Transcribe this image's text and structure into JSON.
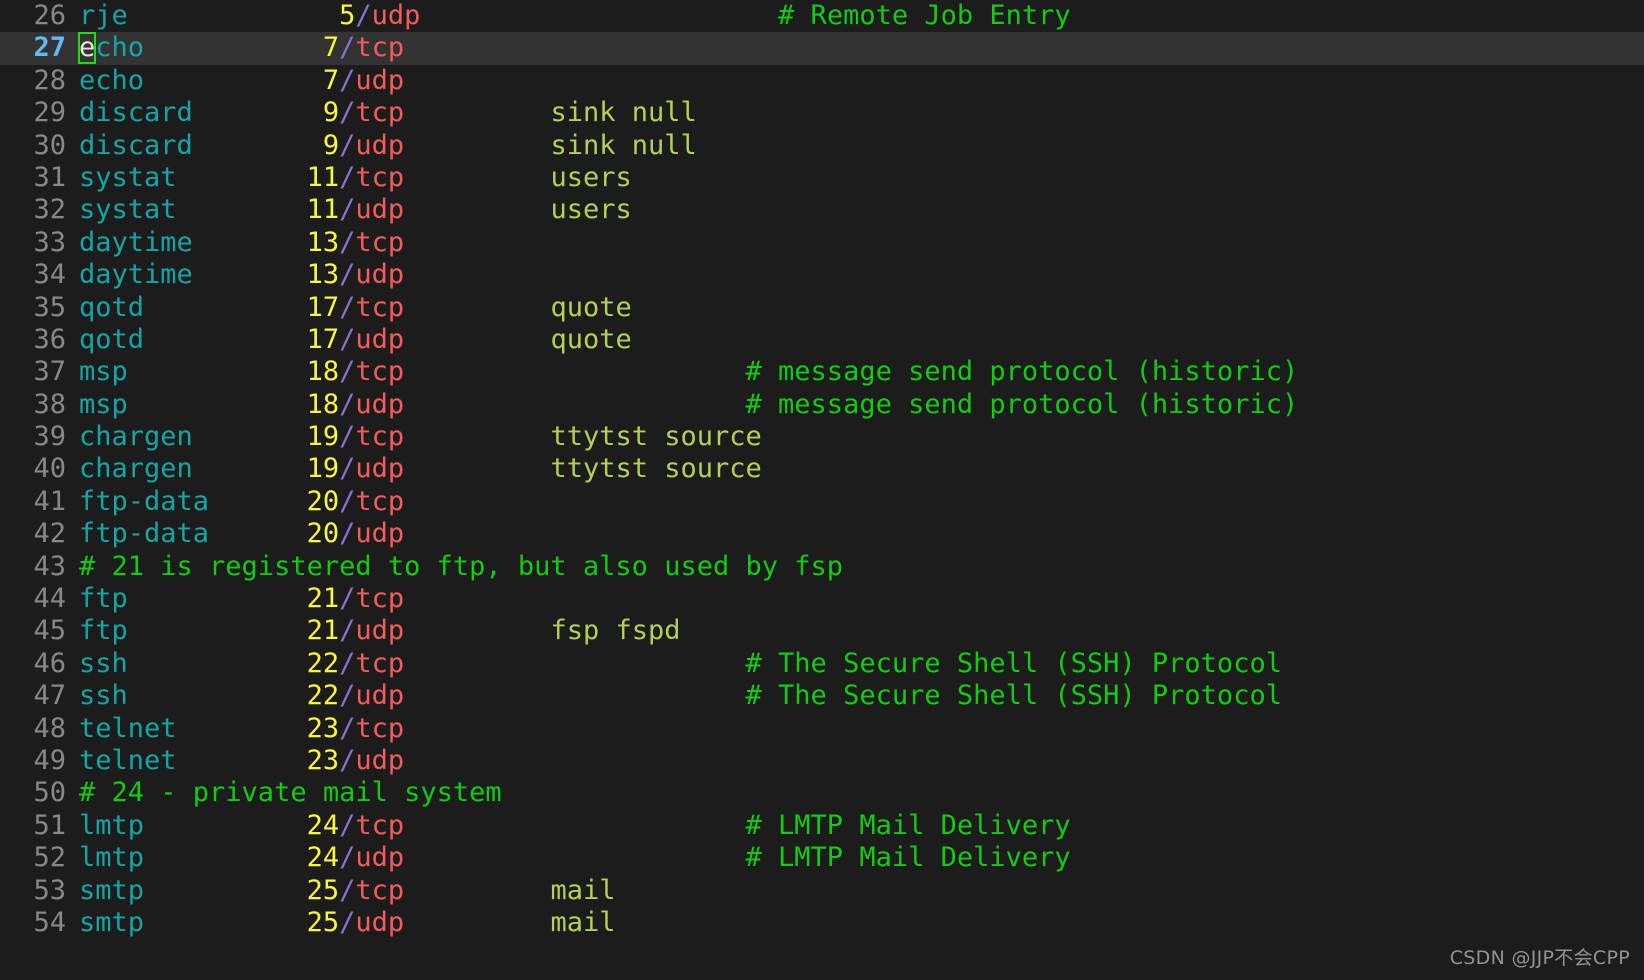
{
  "editor": {
    "kind": "vim-text-editor",
    "file": "/etc/services",
    "mode": "normal",
    "cursor": {
      "line": 27,
      "column": 1,
      "char": "e"
    },
    "colors": {
      "background": "#1c1c1c",
      "cursorline_background": "#333333",
      "line_number": "#888888",
      "cursor_line_number": "#63b8f5",
      "service_name": "#14a5a5",
      "port_number": "#f8f83c",
      "slash": "#8f6fcf",
      "protocol": "#f75b5b",
      "alias": "#b2d157",
      "comment": "#12cc12",
      "cursor_outline": "#1ae01a",
      "watermark": "#9a9a9a"
    },
    "lines": [
      {
        "num": "26",
        "cursorline": false,
        "tokens": [
          {
            "t": "rje",
            "c": "t-service"
          },
          {
            "t": "             ",
            "c": "t-plain"
          },
          {
            "t": "5",
            "c": "t-port"
          },
          {
            "t": "/",
            "c": "t-slash"
          },
          {
            "t": "udp",
            "c": "t-proto"
          },
          {
            "t": "                      ",
            "c": "t-plain"
          },
          {
            "t": "# Remote Job Entry",
            "c": "t-comment"
          }
        ]
      },
      {
        "num": "27",
        "cursorline": true,
        "tokens": [
          {
            "t": "e",
            "c": "t-service",
            "cursor": true
          },
          {
            "t": "cho",
            "c": "t-service"
          },
          {
            "t": "           ",
            "c": "t-plain"
          },
          {
            "t": "7",
            "c": "t-port"
          },
          {
            "t": "/",
            "c": "t-slash"
          },
          {
            "t": "tcp",
            "c": "t-proto"
          }
        ]
      },
      {
        "num": "28",
        "cursorline": false,
        "tokens": [
          {
            "t": "echo",
            "c": "t-service"
          },
          {
            "t": "           ",
            "c": "t-plain"
          },
          {
            "t": "7",
            "c": "t-port"
          },
          {
            "t": "/",
            "c": "t-slash"
          },
          {
            "t": "udp",
            "c": "t-proto"
          }
        ]
      },
      {
        "num": "29",
        "cursorline": false,
        "tokens": [
          {
            "t": "discard",
            "c": "t-service"
          },
          {
            "t": "        ",
            "c": "t-plain"
          },
          {
            "t": "9",
            "c": "t-port"
          },
          {
            "t": "/",
            "c": "t-slash"
          },
          {
            "t": "tcp",
            "c": "t-proto"
          },
          {
            "t": "         ",
            "c": "t-plain"
          },
          {
            "t": "sink null",
            "c": "t-alias"
          }
        ]
      },
      {
        "num": "30",
        "cursorline": false,
        "tokens": [
          {
            "t": "discard",
            "c": "t-service"
          },
          {
            "t": "        ",
            "c": "t-plain"
          },
          {
            "t": "9",
            "c": "t-port"
          },
          {
            "t": "/",
            "c": "t-slash"
          },
          {
            "t": "udp",
            "c": "t-proto"
          },
          {
            "t": "         ",
            "c": "t-plain"
          },
          {
            "t": "sink null",
            "c": "t-alias"
          }
        ]
      },
      {
        "num": "31",
        "cursorline": false,
        "tokens": [
          {
            "t": "systat",
            "c": "t-service"
          },
          {
            "t": "        ",
            "c": "t-plain"
          },
          {
            "t": "11",
            "c": "t-port"
          },
          {
            "t": "/",
            "c": "t-slash"
          },
          {
            "t": "tcp",
            "c": "t-proto"
          },
          {
            "t": "         ",
            "c": "t-plain"
          },
          {
            "t": "users",
            "c": "t-alias"
          }
        ]
      },
      {
        "num": "32",
        "cursorline": false,
        "tokens": [
          {
            "t": "systat",
            "c": "t-service"
          },
          {
            "t": "        ",
            "c": "t-plain"
          },
          {
            "t": "11",
            "c": "t-port"
          },
          {
            "t": "/",
            "c": "t-slash"
          },
          {
            "t": "udp",
            "c": "t-proto"
          },
          {
            "t": "         ",
            "c": "t-plain"
          },
          {
            "t": "users",
            "c": "t-alias"
          }
        ]
      },
      {
        "num": "33",
        "cursorline": false,
        "tokens": [
          {
            "t": "daytime",
            "c": "t-service"
          },
          {
            "t": "       ",
            "c": "t-plain"
          },
          {
            "t": "13",
            "c": "t-port"
          },
          {
            "t": "/",
            "c": "t-slash"
          },
          {
            "t": "tcp",
            "c": "t-proto"
          }
        ]
      },
      {
        "num": "34",
        "cursorline": false,
        "tokens": [
          {
            "t": "daytime",
            "c": "t-service"
          },
          {
            "t": "       ",
            "c": "t-plain"
          },
          {
            "t": "13",
            "c": "t-port"
          },
          {
            "t": "/",
            "c": "t-slash"
          },
          {
            "t": "udp",
            "c": "t-proto"
          }
        ]
      },
      {
        "num": "35",
        "cursorline": false,
        "tokens": [
          {
            "t": "qotd",
            "c": "t-service"
          },
          {
            "t": "          ",
            "c": "t-plain"
          },
          {
            "t": "17",
            "c": "t-port"
          },
          {
            "t": "/",
            "c": "t-slash"
          },
          {
            "t": "tcp",
            "c": "t-proto"
          },
          {
            "t": "         ",
            "c": "t-plain"
          },
          {
            "t": "quote",
            "c": "t-alias"
          }
        ]
      },
      {
        "num": "36",
        "cursorline": false,
        "tokens": [
          {
            "t": "qotd",
            "c": "t-service"
          },
          {
            "t": "          ",
            "c": "t-plain"
          },
          {
            "t": "17",
            "c": "t-port"
          },
          {
            "t": "/",
            "c": "t-slash"
          },
          {
            "t": "udp",
            "c": "t-proto"
          },
          {
            "t": "         ",
            "c": "t-plain"
          },
          {
            "t": "quote",
            "c": "t-alias"
          }
        ]
      },
      {
        "num": "37",
        "cursorline": false,
        "tokens": [
          {
            "t": "msp",
            "c": "t-service"
          },
          {
            "t": "           ",
            "c": "t-plain"
          },
          {
            "t": "18",
            "c": "t-port"
          },
          {
            "t": "/",
            "c": "t-slash"
          },
          {
            "t": "tcp",
            "c": "t-proto"
          },
          {
            "t": "                     ",
            "c": "t-plain"
          },
          {
            "t": "# message send protocol (historic)",
            "c": "t-comment"
          }
        ]
      },
      {
        "num": "38",
        "cursorline": false,
        "tokens": [
          {
            "t": "msp",
            "c": "t-service"
          },
          {
            "t": "           ",
            "c": "t-plain"
          },
          {
            "t": "18",
            "c": "t-port"
          },
          {
            "t": "/",
            "c": "t-slash"
          },
          {
            "t": "udp",
            "c": "t-proto"
          },
          {
            "t": "                     ",
            "c": "t-plain"
          },
          {
            "t": "# message send protocol (historic)",
            "c": "t-comment"
          }
        ]
      },
      {
        "num": "39",
        "cursorline": false,
        "tokens": [
          {
            "t": "chargen",
            "c": "t-service"
          },
          {
            "t": "       ",
            "c": "t-plain"
          },
          {
            "t": "19",
            "c": "t-port"
          },
          {
            "t": "/",
            "c": "t-slash"
          },
          {
            "t": "tcp",
            "c": "t-proto"
          },
          {
            "t": "         ",
            "c": "t-plain"
          },
          {
            "t": "ttytst source",
            "c": "t-alias"
          }
        ]
      },
      {
        "num": "40",
        "cursorline": false,
        "tokens": [
          {
            "t": "chargen",
            "c": "t-service"
          },
          {
            "t": "       ",
            "c": "t-plain"
          },
          {
            "t": "19",
            "c": "t-port"
          },
          {
            "t": "/",
            "c": "t-slash"
          },
          {
            "t": "udp",
            "c": "t-proto"
          },
          {
            "t": "         ",
            "c": "t-plain"
          },
          {
            "t": "ttytst source",
            "c": "t-alias"
          }
        ]
      },
      {
        "num": "41",
        "cursorline": false,
        "tokens": [
          {
            "t": "ftp-data",
            "c": "t-service"
          },
          {
            "t": "      ",
            "c": "t-plain"
          },
          {
            "t": "20",
            "c": "t-port"
          },
          {
            "t": "/",
            "c": "t-slash"
          },
          {
            "t": "tcp",
            "c": "t-proto"
          }
        ]
      },
      {
        "num": "42",
        "cursorline": false,
        "tokens": [
          {
            "t": "ftp-data",
            "c": "t-service"
          },
          {
            "t": "      ",
            "c": "t-plain"
          },
          {
            "t": "20",
            "c": "t-port"
          },
          {
            "t": "/",
            "c": "t-slash"
          },
          {
            "t": "udp",
            "c": "t-proto"
          }
        ]
      },
      {
        "num": "43",
        "cursorline": false,
        "tokens": [
          {
            "t": "# 21 is registered to ftp, but also used by fsp",
            "c": "t-comment"
          }
        ]
      },
      {
        "num": "44",
        "cursorline": false,
        "tokens": [
          {
            "t": "ftp",
            "c": "t-service"
          },
          {
            "t": "           ",
            "c": "t-plain"
          },
          {
            "t": "21",
            "c": "t-port"
          },
          {
            "t": "/",
            "c": "t-slash"
          },
          {
            "t": "tcp",
            "c": "t-proto"
          }
        ]
      },
      {
        "num": "45",
        "cursorline": false,
        "tokens": [
          {
            "t": "ftp",
            "c": "t-service"
          },
          {
            "t": "           ",
            "c": "t-plain"
          },
          {
            "t": "21",
            "c": "t-port"
          },
          {
            "t": "/",
            "c": "t-slash"
          },
          {
            "t": "udp",
            "c": "t-proto"
          },
          {
            "t": "         ",
            "c": "t-plain"
          },
          {
            "t": "fsp fspd",
            "c": "t-alias"
          }
        ]
      },
      {
        "num": "46",
        "cursorline": false,
        "tokens": [
          {
            "t": "ssh",
            "c": "t-service"
          },
          {
            "t": "           ",
            "c": "t-plain"
          },
          {
            "t": "22",
            "c": "t-port"
          },
          {
            "t": "/",
            "c": "t-slash"
          },
          {
            "t": "tcp",
            "c": "t-proto"
          },
          {
            "t": "                     ",
            "c": "t-plain"
          },
          {
            "t": "# The Secure Shell (SSH) Protocol",
            "c": "t-comment"
          }
        ]
      },
      {
        "num": "47",
        "cursorline": false,
        "tokens": [
          {
            "t": "ssh",
            "c": "t-service"
          },
          {
            "t": "           ",
            "c": "t-plain"
          },
          {
            "t": "22",
            "c": "t-port"
          },
          {
            "t": "/",
            "c": "t-slash"
          },
          {
            "t": "udp",
            "c": "t-proto"
          },
          {
            "t": "                     ",
            "c": "t-plain"
          },
          {
            "t": "# The Secure Shell (SSH) Protocol",
            "c": "t-comment"
          }
        ]
      },
      {
        "num": "48",
        "cursorline": false,
        "tokens": [
          {
            "t": "telnet",
            "c": "t-service"
          },
          {
            "t": "        ",
            "c": "t-plain"
          },
          {
            "t": "23",
            "c": "t-port"
          },
          {
            "t": "/",
            "c": "t-slash"
          },
          {
            "t": "tcp",
            "c": "t-proto"
          }
        ]
      },
      {
        "num": "49",
        "cursorline": false,
        "tokens": [
          {
            "t": "telnet",
            "c": "t-service"
          },
          {
            "t": "        ",
            "c": "t-plain"
          },
          {
            "t": "23",
            "c": "t-port"
          },
          {
            "t": "/",
            "c": "t-slash"
          },
          {
            "t": "udp",
            "c": "t-proto"
          }
        ]
      },
      {
        "num": "50",
        "cursorline": false,
        "tokens": [
          {
            "t": "# 24 - private mail system",
            "c": "t-comment"
          }
        ]
      },
      {
        "num": "51",
        "cursorline": false,
        "tokens": [
          {
            "t": "lmtp",
            "c": "t-service"
          },
          {
            "t": "          ",
            "c": "t-plain"
          },
          {
            "t": "24",
            "c": "t-port"
          },
          {
            "t": "/",
            "c": "t-slash"
          },
          {
            "t": "tcp",
            "c": "t-proto"
          },
          {
            "t": "                     ",
            "c": "t-plain"
          },
          {
            "t": "# LMTP Mail Delivery",
            "c": "t-comment"
          }
        ]
      },
      {
        "num": "52",
        "cursorline": false,
        "tokens": [
          {
            "t": "lmtp",
            "c": "t-service"
          },
          {
            "t": "          ",
            "c": "t-plain"
          },
          {
            "t": "24",
            "c": "t-port"
          },
          {
            "t": "/",
            "c": "t-slash"
          },
          {
            "t": "udp",
            "c": "t-proto"
          },
          {
            "t": "                     ",
            "c": "t-plain"
          },
          {
            "t": "# LMTP Mail Delivery",
            "c": "t-comment"
          }
        ]
      },
      {
        "num": "53",
        "cursorline": false,
        "tokens": [
          {
            "t": "smtp",
            "c": "t-service"
          },
          {
            "t": "          ",
            "c": "t-plain"
          },
          {
            "t": "25",
            "c": "t-port"
          },
          {
            "t": "/",
            "c": "t-slash"
          },
          {
            "t": "tcp",
            "c": "t-proto"
          },
          {
            "t": "         ",
            "c": "t-plain"
          },
          {
            "t": "mail",
            "c": "t-alias"
          }
        ]
      },
      {
        "num": "54",
        "cursorline": false,
        "tokens": [
          {
            "t": "smtp",
            "c": "t-service"
          },
          {
            "t": "          ",
            "c": "t-plain"
          },
          {
            "t": "25",
            "c": "t-port"
          },
          {
            "t": "/",
            "c": "t-slash"
          },
          {
            "t": "udp",
            "c": "t-proto"
          },
          {
            "t": "         ",
            "c": "t-plain"
          },
          {
            "t": "mail",
            "c": "t-alias"
          }
        ]
      }
    ]
  },
  "watermark": {
    "text": "CSDN @JJP不会CPP"
  }
}
